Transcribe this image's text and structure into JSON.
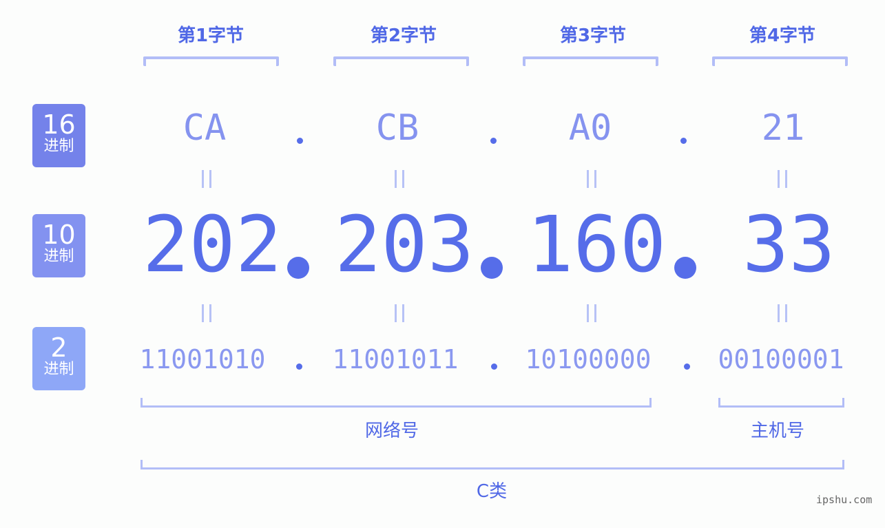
{
  "byte_labels": [
    "第1字节",
    "第2字节",
    "第3字节",
    "第4字节"
  ],
  "rows": {
    "hex": {
      "badge_num": "16",
      "badge_unit": "进制",
      "badge_color": "#7482ea",
      "values": [
        "CA",
        "CB",
        "A0",
        "21"
      ]
    },
    "dec": {
      "badge_num": "10",
      "badge_unit": "进制",
      "badge_color": "#8392f0",
      "values": [
        "202",
        "203",
        "160",
        "33"
      ]
    },
    "bin": {
      "badge_num": "2",
      "badge_unit": "进制",
      "badge_color": "#8ea7f7",
      "values": [
        "11001010",
        "11001011",
        "10100000",
        "00100001"
      ]
    }
  },
  "sections": {
    "network": "网络号",
    "host": "主机号",
    "class": "C类"
  },
  "watermark": "ipshu.com",
  "colors": {
    "accent": "#566de9",
    "bracket": "#b2bdf7"
  }
}
